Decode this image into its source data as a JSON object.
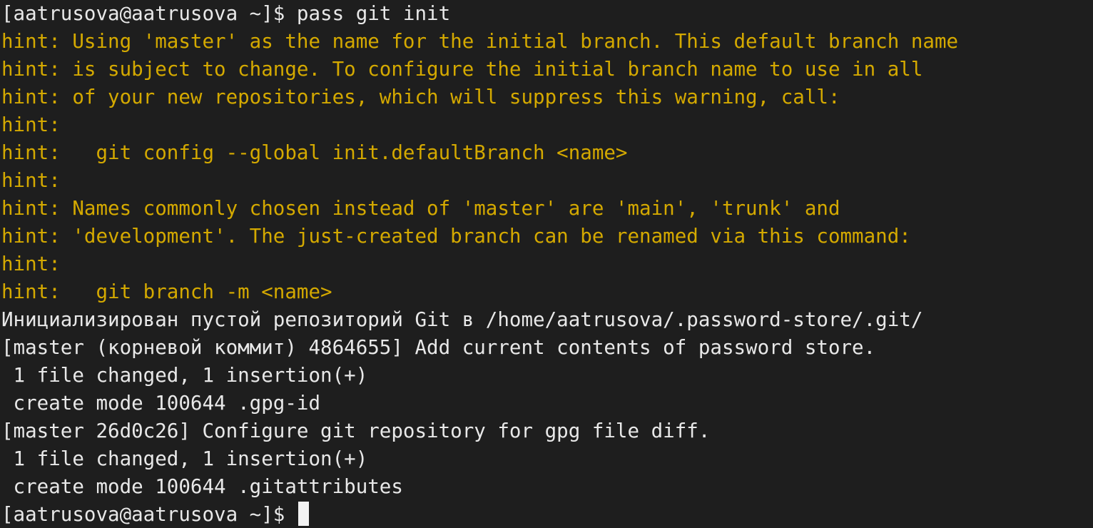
{
  "terminal": {
    "lines": [
      {
        "text": "[aatrusova@aatrusova ~]$ pass git init",
        "type": "prompt"
      },
      {
        "text": "hint: Using 'master' as the name for the initial branch. This default branch name",
        "type": "hint"
      },
      {
        "text": "hint: is subject to change. To configure the initial branch name to use in all",
        "type": "hint"
      },
      {
        "text": "hint: of your new repositories, which will suppress this warning, call:",
        "type": "hint"
      },
      {
        "text": "hint:",
        "type": "hint"
      },
      {
        "text": "hint:   git config --global init.defaultBranch <name>",
        "type": "hint"
      },
      {
        "text": "hint:",
        "type": "hint"
      },
      {
        "text": "hint: Names commonly chosen instead of 'master' are 'main', 'trunk' and",
        "type": "hint"
      },
      {
        "text": "hint: 'development'. The just-created branch can be renamed via this command:",
        "type": "hint"
      },
      {
        "text": "hint:",
        "type": "hint"
      },
      {
        "text": "hint:   git branch -m <name>",
        "type": "hint"
      },
      {
        "text": "Инициализирован пустой репозиторий Git в /home/aatrusova/.password-store/.git/",
        "type": "output"
      },
      {
        "text": "[master (корневой коммит) 4864655] Add current contents of password store.",
        "type": "output"
      },
      {
        "text": " 1 file changed, 1 insertion(+)",
        "type": "output"
      },
      {
        "text": " create mode 100644 .gpg-id",
        "type": "output"
      },
      {
        "text": "[master 26d0c26] Configure git repository for gpg file diff.",
        "type": "output"
      },
      {
        "text": " 1 file changed, 1 insertion(+)",
        "type": "output"
      },
      {
        "text": " create mode 100644 .gitattributes",
        "type": "output"
      }
    ],
    "final_prompt": "[aatrusova@aatrusova ~]$ ",
    "colors": {
      "background": "#1e1e1e",
      "foreground": "#e8e8e8",
      "hint": "#d4a900",
      "cursor": "#f2f2f2"
    }
  }
}
